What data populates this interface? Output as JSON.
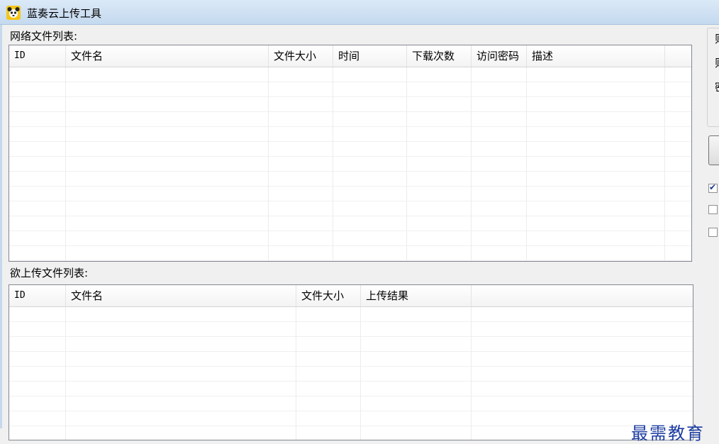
{
  "window": {
    "title": "蓝奏云上传工具"
  },
  "network_list": {
    "label": "网络文件列表:",
    "columns": [
      "ID",
      "文件名",
      "文件大小",
      "时间",
      "下载次数",
      "访问密码",
      "描述"
    ]
  },
  "upload_list": {
    "label": "欲上传文件列表:",
    "columns": [
      "ID",
      "文件名",
      "文件大小",
      "上传结果"
    ]
  },
  "right_panel": {
    "labels": [
      "则",
      "则",
      "密"
    ],
    "checkboxes": [
      {
        "checked": true
      },
      {
        "checked": false
      },
      {
        "checked": false
      }
    ]
  },
  "watermark": "最需教育",
  "colors": {
    "checkmark": "#1a3a8a",
    "watermark": "#1c3ca0",
    "titlebar": "#c4d9ef"
  }
}
